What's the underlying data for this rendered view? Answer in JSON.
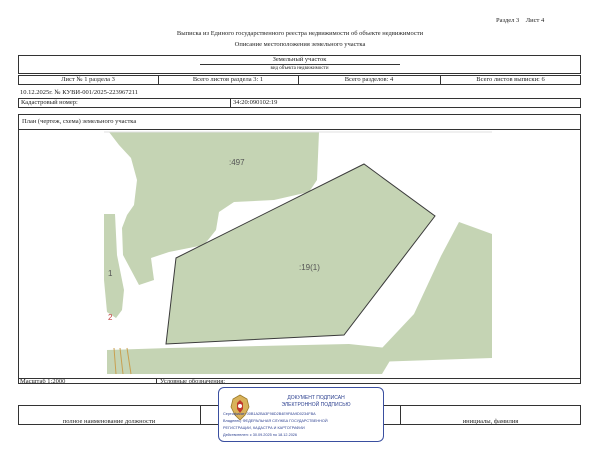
{
  "header": {
    "section": "Раздел 3",
    "sheet": "Лист 4",
    "title": "Выписка из Единого государственного реестра недвижимости об объекте недвижимости",
    "subtitle": "Описание местоположения земельного участка"
  },
  "object": {
    "type": "Земельный участок",
    "type_caption": "вид объекта недвижимости"
  },
  "sheet_info": {
    "sheet_no": "Лист № 1 раздела 3",
    "total_sheets_section": "Всего листов раздела 3: 1",
    "total_sections": "Всего разделов: 4",
    "total_sheets_extract": "Всего листов выписки: 6"
  },
  "record": {
    "date_number": "10.12.2025г. № КУВИ-001/2025-223967211",
    "cadastral_label": "Кадастровый номер:",
    "cadastral_number": "34:20:090102:19"
  },
  "plan": {
    "title": "План (чертеж, схема) земельного участка",
    "label_497": ":497",
    "label_19": ":19(1)",
    "label_1": "1",
    "label_2": "2",
    "colors": {
      "parcel": "#c5d4b4",
      "road": "#ffffff",
      "outline": "#3a3a3a"
    }
  },
  "footer": {
    "scale": "Масштаб 1:2000",
    "legend": "Условные обозначения:",
    "position_caption": "полное наименование должности",
    "name_caption": "инициалы, фамилия"
  },
  "stamp": {
    "line1": "ДОКУМЕНТ ПОДПИСАН",
    "line2": "ЭЛЕКТРОННОЙ ПОДПИСЬЮ",
    "cert": "Сертификат: 00B1A2BA3F98D2B4E9F8A9D0234FBA",
    "owner": "Владелец: ФЕДЕРАЛЬНАЯ СЛУЖБА ГОСУДАРСТВЕННОЙ",
    "owner2": "РЕГИСТРАЦИИ, КАДАСТРА И КАРТОГРАФИИ",
    "valid": "Действителен: с 30.09.2025 по 18.12.2026",
    "emblem": "emblem-icon"
  }
}
